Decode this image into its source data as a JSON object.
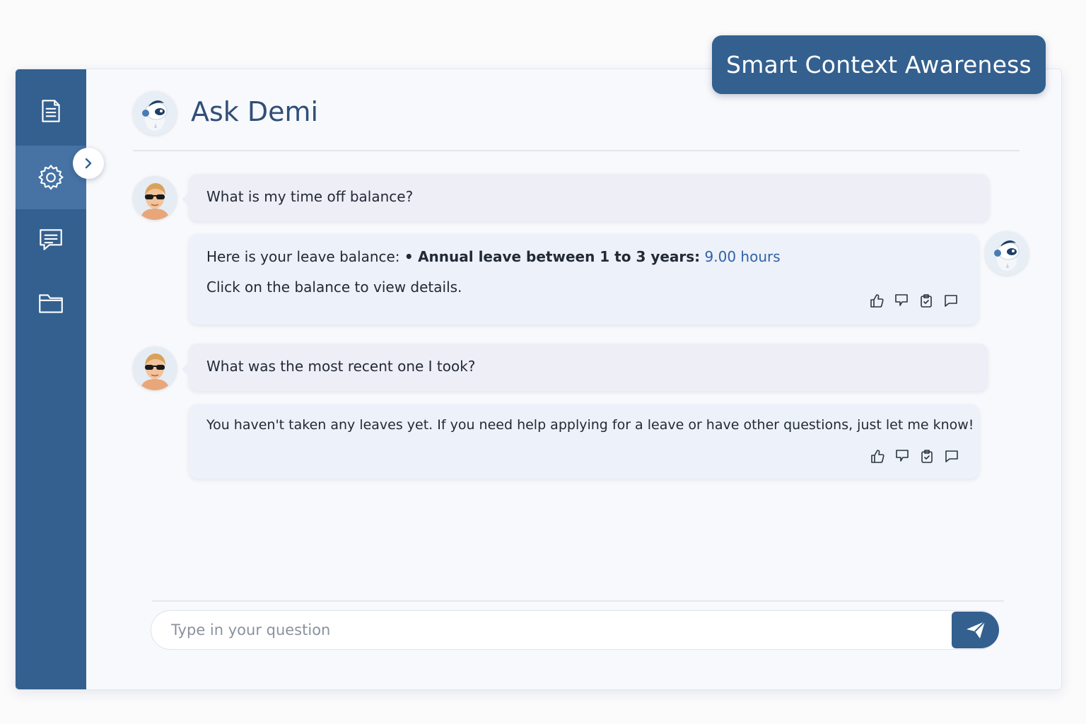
{
  "badge": {
    "label": "Smart Context Awareness"
  },
  "header": {
    "title": "Ask Demi"
  },
  "sidebar": {
    "items": [
      {
        "icon": "document-icon",
        "active": false
      },
      {
        "icon": "gear-icon",
        "active": true
      },
      {
        "icon": "chat-icon",
        "active": false
      },
      {
        "icon": "folder-icon",
        "active": false
      }
    ],
    "expand_icon": "chevron-right-icon"
  },
  "messages": [
    {
      "role": "user",
      "text": "What is my time off balance?"
    },
    {
      "role": "bot",
      "intro": "Here is your leave balance:",
      "bullet": "•",
      "item_label": "Annual leave between 1 to 3 years:",
      "item_value": "9.00 hours",
      "line2": "Click on the balance to view details."
    },
    {
      "role": "user",
      "text": "What was the most recent one I took?"
    },
    {
      "role": "bot",
      "text": "You haven't taken any leaves yet. If you need help applying for a leave or have other questions, just let me know!"
    }
  ],
  "message_actions": [
    "thumbs-up-icon",
    "thumbs-down-icon",
    "clipboard-icon",
    "comment-icon"
  ],
  "input": {
    "placeholder": "Type in your question",
    "send_icon": "send-icon"
  },
  "colors": {
    "primary": "#33608f",
    "sidebar_active": "#4673a4",
    "link": "#2f62a8"
  }
}
